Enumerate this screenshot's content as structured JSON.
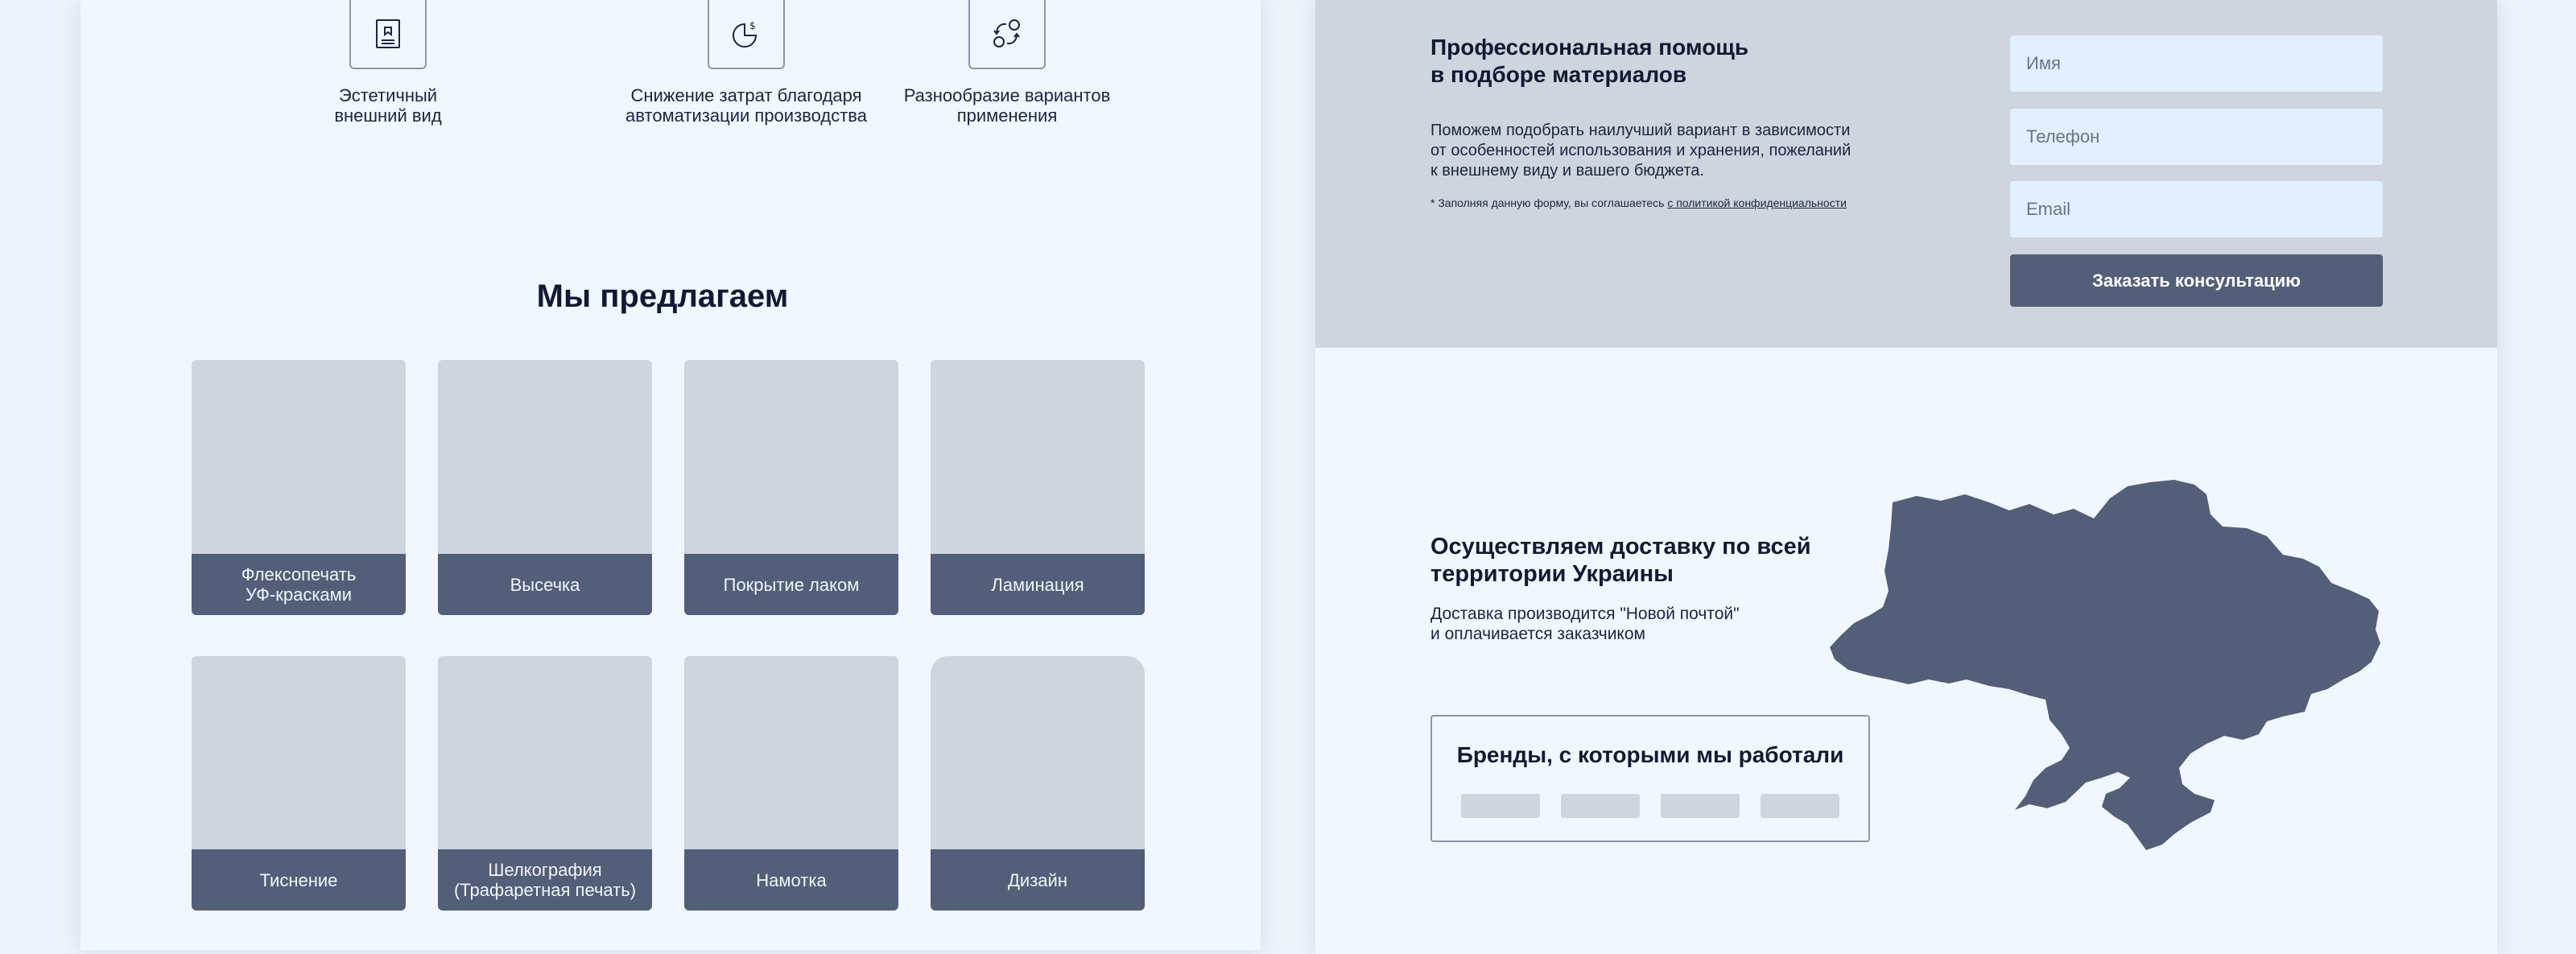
{
  "features": [
    {
      "label": "Эстетичный\nвнешний вид",
      "icon": "certificate-icon"
    },
    {
      "label": "Снижение затрат благодаря\nавтоматизации производства",
      "icon": "cost-chart-icon"
    },
    {
      "label": "Разнообразие вариантов\nприменения",
      "icon": "variants-icon"
    }
  ],
  "offers": {
    "title": "Мы предлагаем",
    "items": [
      {
        "label": "Флексопечать\nУФ-красками"
      },
      {
        "label": "Высечка"
      },
      {
        "label": "Покрытие лаком"
      },
      {
        "label": "Ламинация"
      },
      {
        "label": "Тиснение"
      },
      {
        "label": "Шелкография\n(Трафаретная печать)"
      },
      {
        "label": "Намотка"
      },
      {
        "label": "Дизайн"
      }
    ]
  },
  "consultation": {
    "title": "Профессиональная помощь\nв подборе материалов",
    "description": "Поможем подобрать наилучший вариант в  зависимости\nот особенностей использования и хранения, пожеланий\nк внешнему виду и вашего бюджета.",
    "note_prefix": "* Заполняя данную форму, вы соглашаетесь ",
    "note_link": "с политикой конфиденциальности",
    "name_placeholder": "Имя",
    "phone_placeholder": "Телефон",
    "email_placeholder": "Email",
    "submit_label": "Заказать консультацию"
  },
  "delivery": {
    "title": "Осуществляем доставку по всей\nтерритории Украины",
    "description": "Доставка производится \"Новой почтой\"\nи оплачивается заказчиком",
    "map_icon": "ukraine-map"
  },
  "brands": {
    "title": "Бренды, с которыми мы работали",
    "logo_count": 4
  },
  "colors": {
    "accent": "#535f79",
    "placeholder_gray": "#cfd5de",
    "background": "#f1f7ff",
    "input_bg": "#e2efff"
  }
}
